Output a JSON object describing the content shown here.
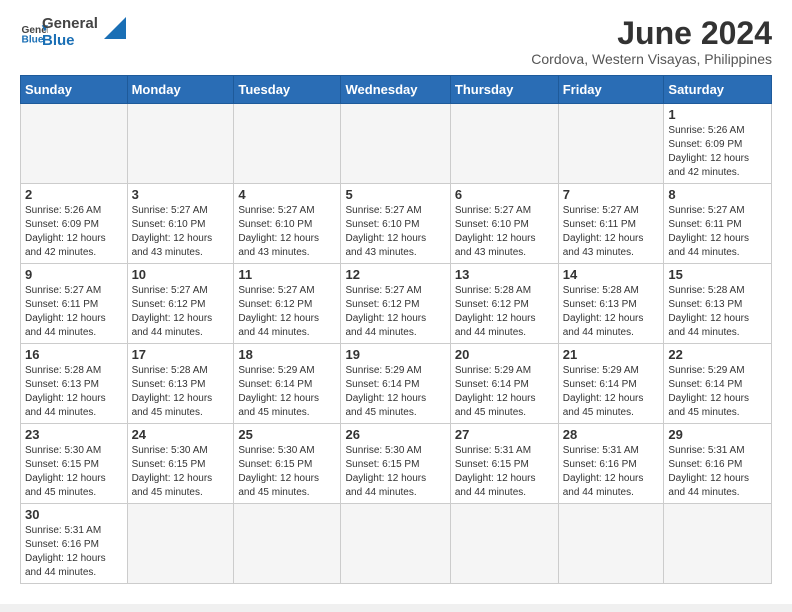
{
  "header": {
    "logo_general": "General",
    "logo_blue": "Blue",
    "title": "June 2024",
    "subtitle": "Cordova, Western Visayas, Philippines"
  },
  "days_of_week": [
    "Sunday",
    "Monday",
    "Tuesday",
    "Wednesday",
    "Thursday",
    "Friday",
    "Saturday"
  ],
  "weeks": [
    [
      {
        "day": "",
        "info": ""
      },
      {
        "day": "",
        "info": ""
      },
      {
        "day": "",
        "info": ""
      },
      {
        "day": "",
        "info": ""
      },
      {
        "day": "",
        "info": ""
      },
      {
        "day": "",
        "info": ""
      },
      {
        "day": "1",
        "info": "Sunrise: 5:26 AM\nSunset: 6:09 PM\nDaylight: 12 hours\nand 42 minutes."
      }
    ],
    [
      {
        "day": "2",
        "info": "Sunrise: 5:26 AM\nSunset: 6:09 PM\nDaylight: 12 hours\nand 42 minutes."
      },
      {
        "day": "3",
        "info": "Sunrise: 5:27 AM\nSunset: 6:10 PM\nDaylight: 12 hours\nand 43 minutes."
      },
      {
        "day": "4",
        "info": "Sunrise: 5:27 AM\nSunset: 6:10 PM\nDaylight: 12 hours\nand 43 minutes."
      },
      {
        "day": "5",
        "info": "Sunrise: 5:27 AM\nSunset: 6:10 PM\nDaylight: 12 hours\nand 43 minutes."
      },
      {
        "day": "6",
        "info": "Sunrise: 5:27 AM\nSunset: 6:10 PM\nDaylight: 12 hours\nand 43 minutes."
      },
      {
        "day": "7",
        "info": "Sunrise: 5:27 AM\nSunset: 6:11 PM\nDaylight: 12 hours\nand 43 minutes."
      },
      {
        "day": "8",
        "info": "Sunrise: 5:27 AM\nSunset: 6:11 PM\nDaylight: 12 hours\nand 44 minutes."
      }
    ],
    [
      {
        "day": "9",
        "info": "Sunrise: 5:27 AM\nSunset: 6:11 PM\nDaylight: 12 hours\nand 44 minutes."
      },
      {
        "day": "10",
        "info": "Sunrise: 5:27 AM\nSunset: 6:12 PM\nDaylight: 12 hours\nand 44 minutes."
      },
      {
        "day": "11",
        "info": "Sunrise: 5:27 AM\nSunset: 6:12 PM\nDaylight: 12 hours\nand 44 minutes."
      },
      {
        "day": "12",
        "info": "Sunrise: 5:27 AM\nSunset: 6:12 PM\nDaylight: 12 hours\nand 44 minutes."
      },
      {
        "day": "13",
        "info": "Sunrise: 5:28 AM\nSunset: 6:12 PM\nDaylight: 12 hours\nand 44 minutes."
      },
      {
        "day": "14",
        "info": "Sunrise: 5:28 AM\nSunset: 6:13 PM\nDaylight: 12 hours\nand 44 minutes."
      },
      {
        "day": "15",
        "info": "Sunrise: 5:28 AM\nSunset: 6:13 PM\nDaylight: 12 hours\nand 44 minutes."
      }
    ],
    [
      {
        "day": "16",
        "info": "Sunrise: 5:28 AM\nSunset: 6:13 PM\nDaylight: 12 hours\nand 44 minutes."
      },
      {
        "day": "17",
        "info": "Sunrise: 5:28 AM\nSunset: 6:13 PM\nDaylight: 12 hours\nand 45 minutes."
      },
      {
        "day": "18",
        "info": "Sunrise: 5:29 AM\nSunset: 6:14 PM\nDaylight: 12 hours\nand 45 minutes."
      },
      {
        "day": "19",
        "info": "Sunrise: 5:29 AM\nSunset: 6:14 PM\nDaylight: 12 hours\nand 45 minutes."
      },
      {
        "day": "20",
        "info": "Sunrise: 5:29 AM\nSunset: 6:14 PM\nDaylight: 12 hours\nand 45 minutes."
      },
      {
        "day": "21",
        "info": "Sunrise: 5:29 AM\nSunset: 6:14 PM\nDaylight: 12 hours\nand 45 minutes."
      },
      {
        "day": "22",
        "info": "Sunrise: 5:29 AM\nSunset: 6:14 PM\nDaylight: 12 hours\nand 45 minutes."
      }
    ],
    [
      {
        "day": "23",
        "info": "Sunrise: 5:30 AM\nSunset: 6:15 PM\nDaylight: 12 hours\nand 45 minutes."
      },
      {
        "day": "24",
        "info": "Sunrise: 5:30 AM\nSunset: 6:15 PM\nDaylight: 12 hours\nand 45 minutes."
      },
      {
        "day": "25",
        "info": "Sunrise: 5:30 AM\nSunset: 6:15 PM\nDaylight: 12 hours\nand 45 minutes."
      },
      {
        "day": "26",
        "info": "Sunrise: 5:30 AM\nSunset: 6:15 PM\nDaylight: 12 hours\nand 44 minutes."
      },
      {
        "day": "27",
        "info": "Sunrise: 5:31 AM\nSunset: 6:15 PM\nDaylight: 12 hours\nand 44 minutes."
      },
      {
        "day": "28",
        "info": "Sunrise: 5:31 AM\nSunset: 6:16 PM\nDaylight: 12 hours\nand 44 minutes."
      },
      {
        "day": "29",
        "info": "Sunrise: 5:31 AM\nSunset: 6:16 PM\nDaylight: 12 hours\nand 44 minutes."
      }
    ],
    [
      {
        "day": "30",
        "info": "Sunrise: 5:31 AM\nSunset: 6:16 PM\nDaylight: 12 hours\nand 44 minutes."
      },
      {
        "day": "",
        "info": ""
      },
      {
        "day": "",
        "info": ""
      },
      {
        "day": "",
        "info": ""
      },
      {
        "day": "",
        "info": ""
      },
      {
        "day": "",
        "info": ""
      },
      {
        "day": "",
        "info": ""
      }
    ]
  ]
}
